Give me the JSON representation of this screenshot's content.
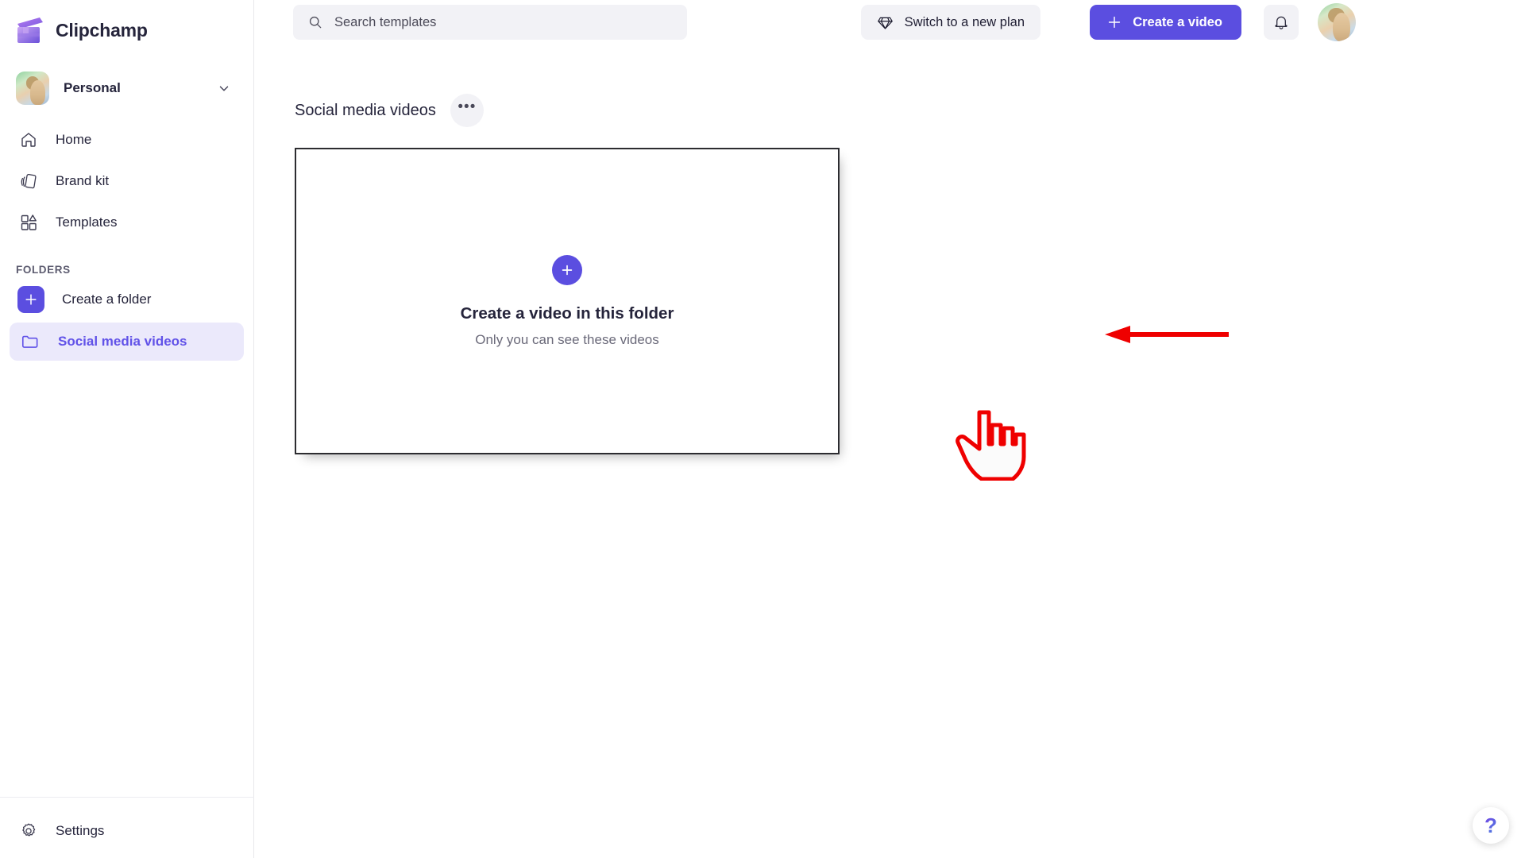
{
  "app": {
    "name": "Clipchamp",
    "logo_icon": "clipchamp-logo-icon"
  },
  "sidebar": {
    "account": {
      "name": "Personal",
      "avatar_icon": "account-avatar",
      "chevron_icon": "chevron-down-icon"
    },
    "nav_items": [
      {
        "label": "Home",
        "icon": "home-icon"
      },
      {
        "label": "Brand kit",
        "icon": "brand-kit-icon"
      },
      {
        "label": "Templates",
        "icon": "templates-icon"
      }
    ],
    "folders_section_label": "FOLDERS",
    "create_folder": {
      "label": "Create a folder",
      "icon": "plus-icon"
    },
    "folders": [
      {
        "label": "Social media videos",
        "icon": "folder-icon",
        "selected": true
      }
    ],
    "bottom": {
      "label": "Settings",
      "icon": "gear-icon"
    }
  },
  "topbar": {
    "search": {
      "placeholder": "Search templates",
      "value": "",
      "icon": "search-icon"
    },
    "plan_button": {
      "label": "Switch to a new plan",
      "icon": "diamond-icon"
    },
    "create_video_button": {
      "label": "Create a video",
      "icon": "plus-icon"
    },
    "notifications_icon": "bell-icon",
    "profile_avatar_icon": "avatar"
  },
  "main": {
    "folder_title": "Social media videos",
    "more_button_label": "•••",
    "empty_card": {
      "plus_icon": "plus-icon",
      "title": "Create a video in this folder",
      "subtitle": "Only you can see these videos"
    }
  },
  "annotations": {
    "arrow_icon": "red-arrow-left-icon",
    "cursor_icon": "pointing-hand-cursor-icon",
    "arrow_color": "#ef0000",
    "cursor_color": "#ef0000"
  },
  "help": {
    "icon": "question-mark-icon",
    "label": "?"
  },
  "colors": {
    "accent": "#5b4ee0",
    "selected_folder_bg": "#ebe9fb",
    "selected_folder_text": "#6152e8",
    "chrome_bg": "#f2f2f6",
    "text_primary": "#25243b"
  }
}
